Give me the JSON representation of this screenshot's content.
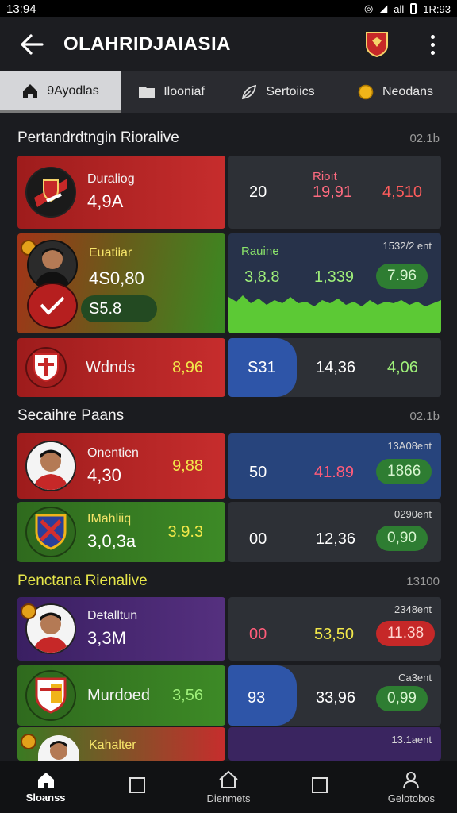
{
  "status_bar": {
    "time": "13:94",
    "right_time": "1R:93",
    "signal": "all"
  },
  "app_bar": {
    "title": "OLAHRIDJAIASIA"
  },
  "tabs": [
    {
      "label": "9Ayodlas",
      "icon": "home-icon",
      "active": true
    },
    {
      "label": "Ilooniaf",
      "icon": "folder-icon",
      "active": false
    },
    {
      "label": "Sertoiics",
      "icon": "leaf-icon",
      "active": false
    },
    {
      "label": "Neodans",
      "icon": "medal-icon",
      "active": false
    }
  ],
  "sections": [
    {
      "title": "Pertandrdtngin Rioralive",
      "meta": "02.1b",
      "rows": [
        {
          "label": "Duraliog",
          "value": "4,9A",
          "right": [
            "20",
            "19,91",
            "4,510"
          ]
        },
        {
          "label": "Euatiiar",
          "value": "4S0,80",
          "sub": "S5.8",
          "chart_label": "Rauine",
          "chart_meta": "1532/2 ent",
          "right": [
            "3,8.8",
            "1,339",
            "7.96"
          ]
        },
        {
          "label": "Wdnds",
          "side": "8,96",
          "right": [
            "S31",
            "14,36",
            "4,06"
          ]
        }
      ]
    },
    {
      "title": "Secaihre Paans",
      "meta": "02.1b",
      "rows": [
        {
          "label": "Onentien",
          "value": "4,30",
          "side": "9,88",
          "meta": "13A08ent",
          "right": [
            "50",
            "41.89",
            "1866"
          ]
        },
        {
          "label": "IMahliiq",
          "value": "3,0,3a",
          "side": "3.9.3",
          "meta": "0290ent",
          "right": [
            "00",
            "12,36",
            "0,90"
          ]
        }
      ]
    },
    {
      "title": "Penctana Rienalive",
      "meta": "13100",
      "rows": [
        {
          "label": "Detalltun",
          "value": "3,3M",
          "meta": "2348ent",
          "right": [
            "00",
            "53,50",
            "11.38"
          ]
        },
        {
          "label": "Murdoed",
          "side": "3,56",
          "meta": "Ca3ent",
          "right": [
            "93",
            "33,96",
            "0,99"
          ]
        },
        {
          "label": "Kahalter",
          "meta": "13.1aent"
        }
      ]
    }
  ],
  "bottom_nav": [
    {
      "label": "Sloanss",
      "icon": "home-icon",
      "active": true
    },
    {
      "label": "",
      "icon": "square-icon",
      "active": false
    },
    {
      "label": "Dienmets",
      "icon": "house-outline-icon",
      "active": false
    },
    {
      "label": "",
      "icon": "square-icon",
      "active": false
    },
    {
      "label": "Gelotobos",
      "icon": "person-icon",
      "active": false
    }
  ]
}
